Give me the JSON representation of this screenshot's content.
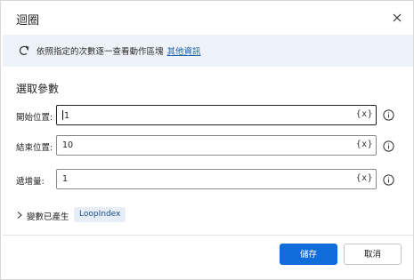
{
  "dialog": {
    "title": "迴圈"
  },
  "banner": {
    "text": "依照指定的次數逐一查看動作區塊",
    "link": "其他資訊"
  },
  "parameters": {
    "section_title": "選取參數",
    "fields": [
      {
        "label": "開始位置:",
        "value": "1",
        "var_button": "{x}"
      },
      {
        "label": "結束位置:",
        "value": "10",
        "var_button": "{x}"
      },
      {
        "label": "遞增量:",
        "value": "1",
        "var_button": "{x}"
      }
    ]
  },
  "variables": {
    "label": "變數已產生",
    "chip": "LoopIndex"
  },
  "footer": {
    "save_label": "儲存",
    "cancel_label": "取消"
  },
  "colors": {
    "primary": "#0f6cdb",
    "banner_bg": "#eef3f9",
    "link": "#1a5fb4",
    "chip_bg": "#e7eef8"
  },
  "icons": {
    "close": "close-icon",
    "banner": "loop-icon",
    "info": "info-icon",
    "chevron": "chevron-right-icon"
  }
}
